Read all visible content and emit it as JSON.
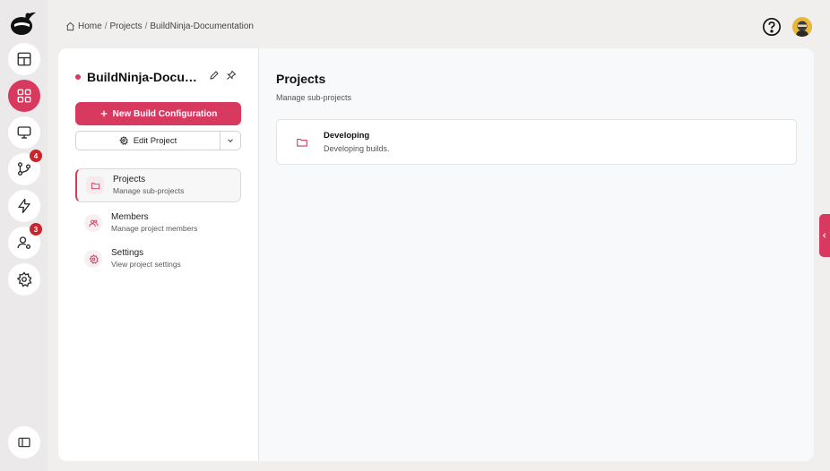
{
  "breadcrumb": {
    "home": "Home",
    "projects": "Projects",
    "current": "BuildNinja-Documentation",
    "separator": "/"
  },
  "rail": {
    "items": [
      {
        "icon": "dashboard-icon"
      },
      {
        "icon": "projects-grid-icon",
        "active": true
      },
      {
        "icon": "monitor-icon"
      },
      {
        "icon": "git-branch-icon",
        "badge": "4"
      },
      {
        "icon": "lightning-icon"
      },
      {
        "icon": "user-settings-icon",
        "badge": "3"
      },
      {
        "icon": "gear-icon"
      }
    ],
    "bottom_icon": "sidebar-toggle-icon"
  },
  "project": {
    "name": "BuildNinja-Documentation",
    "new_build_label": "New Build Configuration",
    "edit_label": "Edit Project"
  },
  "nav": [
    {
      "title": "Projects",
      "subtitle": "Manage sub-projects",
      "active": true
    },
    {
      "title": "Members",
      "subtitle": "Manage project members"
    },
    {
      "title": "Settings",
      "subtitle": "View project settings"
    }
  ],
  "main": {
    "title": "Projects",
    "subtitle": "Manage sub-projects",
    "subprojects": [
      {
        "name": "Developing",
        "description": "Developing builds."
      }
    ]
  },
  "colors": {
    "accent": "#d8395f",
    "badge": "#c8252c",
    "background": "#f1eeee"
  }
}
